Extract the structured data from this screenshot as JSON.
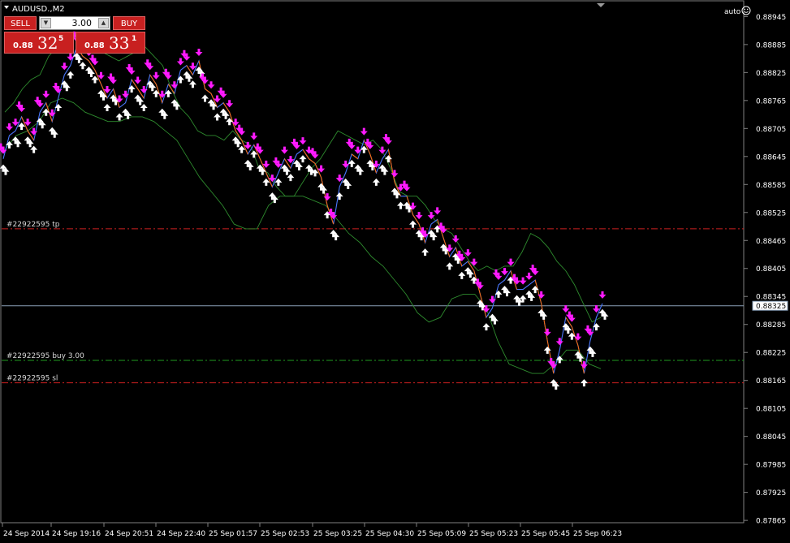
{
  "window": {
    "symbol_title": "AUDUSD.,M2",
    "auto_label": "auto"
  },
  "trade_panel": {
    "sell_label": "SELL",
    "buy_label": "BUY",
    "volume": "3.00",
    "sell_price": {
      "prefix": "0.88",
      "big": "32",
      "sup": "5"
    },
    "buy_price": {
      "prefix": "0.88",
      "big": "33",
      "sup": "1"
    }
  },
  "colors": {
    "background": "#000000",
    "price_line": "#4a78ff",
    "band": "#2e8b2e",
    "arrow_up": "#ffffff",
    "arrow_down": "#ff1aff",
    "tp_sl_line": "#cc2020",
    "entry_line": "#1f9a1f",
    "bid_line": "#8aa0b8"
  },
  "order_lines": {
    "tp": {
      "label": "#22922595 tp",
      "price": 0.8849
    },
    "entry": {
      "label": "#22922595 buy 3.00",
      "price": 0.88208
    },
    "sl": {
      "label": "#22922595 sl",
      "price": 0.8816
    }
  },
  "current_price": "0.88325",
  "y_axis": {
    "min": 0.8786,
    "max": 0.8897,
    "ticks": [
      "0.88945",
      "0.88885",
      "0.88825",
      "0.88765",
      "0.88705",
      "0.88645",
      "0.88585",
      "0.88525",
      "0.88465",
      "0.88405",
      "0.88345",
      "0.88285",
      "0.88225",
      "0.88165",
      "0.88105",
      "0.88045",
      "0.87985",
      "0.87925",
      "0.87865"
    ]
  },
  "x_axis": {
    "labels": [
      "24 Sep 2014",
      "24 Sep 19:16",
      "24 Sep 20:51",
      "24 Sep 22:40",
      "25 Sep 01:57",
      "25 Sep 02:53",
      "25 Sep 03:25",
      "25 Sep 04:30",
      "25 Sep 05:09",
      "25 Sep 05:23",
      "25 Sep 05:45",
      "25 Sep 06:23"
    ]
  },
  "chart_data": {
    "type": "line",
    "title": "AUDUSD.,M2",
    "ylim": [
      0.8786,
      0.8897
    ],
    "series": [
      {
        "values": [
          0.8864,
          0.8869,
          0.887,
          0.8873,
          0.887,
          0.8868,
          0.8874,
          0.8876,
          0.8872,
          0.8877,
          0.8882,
          0.8884,
          0.8888,
          0.8886,
          0.8885,
          0.8883,
          0.888,
          0.8877,
          0.8879,
          0.8875,
          0.8876,
          0.8881,
          0.8879,
          0.8877,
          0.8882,
          0.888,
          0.8876,
          0.888,
          0.8878,
          0.8883,
          0.8884,
          0.8882,
          0.8885,
          0.8879,
          0.8878,
          0.8875,
          0.8876,
          0.8874,
          0.887,
          0.8868,
          0.8865,
          0.8867,
          0.8864,
          0.8861,
          0.8858,
          0.8861,
          0.8864,
          0.8862,
          0.8865,
          0.8866,
          0.8864,
          0.8863,
          0.886,
          0.8854,
          0.885,
          0.8858,
          0.8861,
          0.8865,
          0.8864,
          0.8868,
          0.8865,
          0.8861,
          0.8864,
          0.8866,
          0.8859,
          0.8856,
          0.8856,
          0.8852,
          0.885,
          0.8846,
          0.885,
          0.8851,
          0.8847,
          0.8843,
          0.8845,
          0.8841,
          0.8842,
          0.884,
          0.8835,
          0.883,
          0.8832,
          0.8837,
          0.8838,
          0.884,
          0.8836,
          0.8836,
          0.8837,
          0.8838,
          0.8833,
          0.8825,
          0.8818,
          0.8823,
          0.883,
          0.8828,
          0.8824,
          0.8818,
          0.8825,
          0.883,
          0.8833
        ]
      },
      {
        "values": [
          0.8874,
          0.8876,
          0.8879,
          0.8881,
          0.8882,
          0.8886,
          0.8888,
          0.889,
          0.8891,
          0.8889,
          0.8888,
          0.8887,
          0.8886,
          0.8885,
          0.8886,
          0.8887,
          0.8888,
          0.8886,
          0.8884,
          0.8879,
          0.8875,
          0.8873,
          0.887,
          0.8869,
          0.8869,
          0.8868,
          0.887,
          0.8868,
          0.8867,
          0.8862,
          0.8861,
          0.8858,
          0.8856,
          0.8856,
          0.8859,
          0.8862,
          0.8864,
          0.8867,
          0.887,
          0.8869,
          0.8868,
          0.8867,
          0.8868,
          0.8866,
          0.8862,
          0.8857,
          0.8856,
          0.8856,
          0.8854,
          0.8851,
          0.8849,
          0.8848,
          0.8845,
          0.8842,
          0.884,
          0.8841,
          0.884,
          0.8841,
          0.8841,
          0.8844,
          0.8848,
          0.8847,
          0.8845,
          0.8842,
          0.884,
          0.8837,
          0.8833,
          0.8829,
          0.883
        ]
      },
      {
        "values": [
          0.8866,
          0.8869,
          0.887,
          0.8872,
          0.8876,
          0.8877,
          0.8876,
          0.8874,
          0.8873,
          0.8872,
          0.8872,
          0.8873,
          0.8873,
          0.8872,
          0.887,
          0.8868,
          0.8864,
          0.886,
          0.8857,
          0.8854,
          0.885,
          0.8849,
          0.8849,
          0.8854,
          0.8856,
          0.8856,
          0.8856,
          0.8855,
          0.8854,
          0.8851,
          0.8848,
          0.8846,
          0.8843,
          0.8841,
          0.8838,
          0.8835,
          0.8831,
          0.8829,
          0.883,
          0.8834,
          0.8835,
          0.8835,
          0.8832,
          0.8825,
          0.882,
          0.8819,
          0.8818,
          0.8818,
          0.882,
          0.8823,
          0.8823,
          0.882,
          0.8819
        ]
      }
    ],
    "grid": false,
    "legend": "none"
  }
}
